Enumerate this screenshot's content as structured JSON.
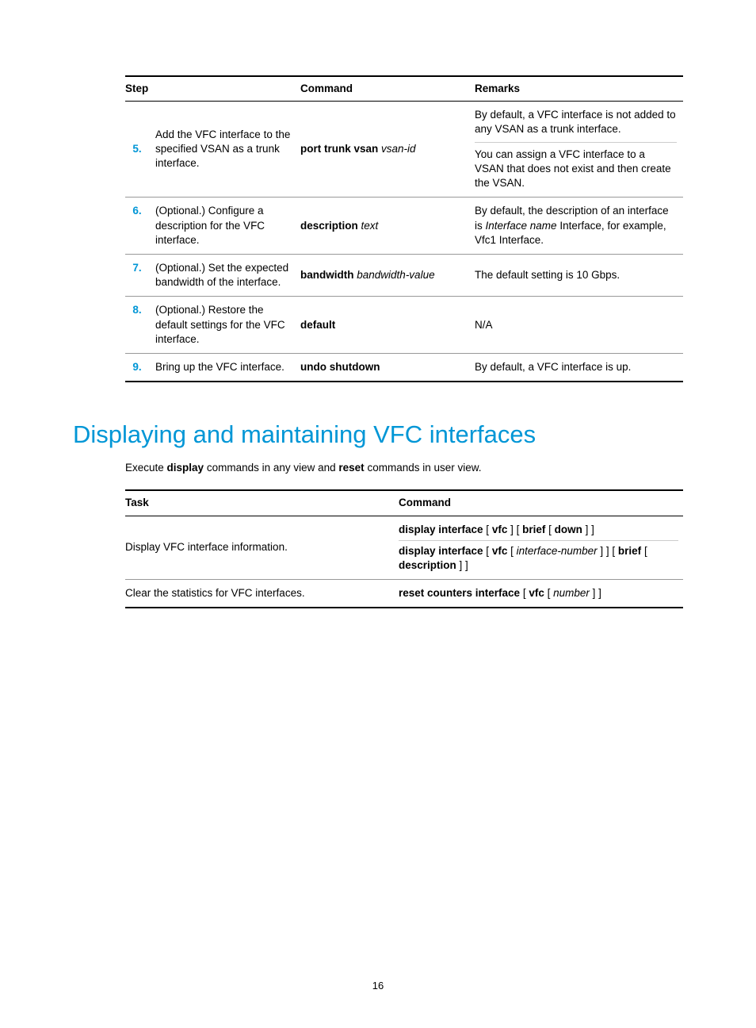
{
  "t1": {
    "h_step": "Step",
    "h_cmd": "Command",
    "h_rem": "Remarks",
    "rows": [
      {
        "num": "5.",
        "desc": "Add the VFC interface to the specified VSAN as a trunk interface.",
        "cmd_b": "port trunk vsan",
        "cmd_i": "vsan-id",
        "rem1": "By default, a VFC interface is not added to any VSAN as a trunk interface.",
        "rem2": "You can assign a VFC interface to a VSAN that does not exist and then create the VSAN."
      },
      {
        "num": "6.",
        "desc": "(Optional.) Configure a description for the VFC interface.",
        "cmd_b": "description",
        "cmd_i": "text",
        "rem_pre": "By default, the description of an interface is ",
        "rem_mid_i": "Interface name",
        "rem_post": " Interface, for example, Vfc1 Interface."
      },
      {
        "num": "7.",
        "desc": "(Optional.) Set the expected bandwidth of the interface.",
        "cmd_b": "bandwidth",
        "cmd_i": "bandwidth-value",
        "rem": "The default setting is 10 Gbps."
      },
      {
        "num": "8.",
        "desc": "(Optional.) Restore the default settings for the VFC interface.",
        "cmd_b": "default",
        "rem": "N/A"
      },
      {
        "num": "9.",
        "desc": "Bring up the VFC interface.",
        "cmd_b": "undo shutdown",
        "rem": "By default, a VFC interface is up."
      }
    ]
  },
  "heading": "Displaying and maintaining VFC interfaces",
  "intro_pre": "Execute ",
  "intro_b1": "display",
  "intro_mid": " commands in any view and ",
  "intro_b2": "reset",
  "intro_post": " commands in user view.",
  "t2": {
    "h_task": "Task",
    "h_cmd": "Command",
    "r1_task": "Display VFC interface information.",
    "r1c1_a": "display interface",
    "r1c1_b": " [ ",
    "r1c1_c": "vfc",
    "r1c1_d": " ] [ ",
    "r1c1_e": "brief",
    "r1c1_f": " [ ",
    "r1c1_g": "down",
    "r1c1_h": " ] ]",
    "r1c2_a": "display interface",
    "r1c2_b": " [ ",
    "r1c2_c": "vfc",
    "r1c2_d": " [ ",
    "r1c2_e": "interface-number",
    "r1c2_f": " ] ] [ ",
    "r1c2_g": "brief",
    "r1c2_h": " [ ",
    "r1c2_i": "description",
    "r1c2_j": " ] ]",
    "r2_task": "Clear the statistics for VFC interfaces.",
    "r2c_a": "reset counters interface",
    "r2c_b": " [ ",
    "r2c_c": "vfc",
    "r2c_d": " [ ",
    "r2c_e": "number",
    "r2c_f": " ] ]"
  },
  "page_number": "16"
}
